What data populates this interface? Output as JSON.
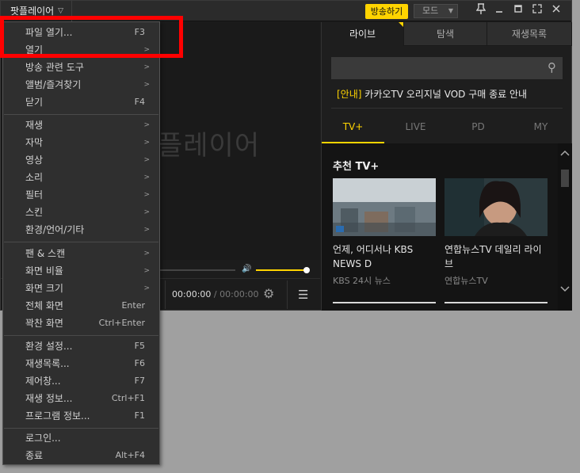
{
  "titlebar": {
    "app_menu_label": "팟플레이어",
    "broadcast_label": "방송하기",
    "mode_label": "모드"
  },
  "video": {
    "watermark": "플레이어",
    "time_current": "00:00:00",
    "time_separator": "/",
    "time_total": "00:00:00",
    "volume_level": 1.0
  },
  "panel": {
    "tabs": [
      {
        "label": "라이브"
      },
      {
        "label": "탐색"
      },
      {
        "label": "재생목록"
      }
    ],
    "notice_tag": "[안내]",
    "notice_text": "카카오TV 오리지널 VOD 구매 종료 안내",
    "subtabs": [
      {
        "label": "TV+"
      },
      {
        "label": "LIVE"
      },
      {
        "label": "PD"
      },
      {
        "label": "MY"
      }
    ],
    "section_title": "추천 TV+",
    "cards": [
      {
        "title": "언제, 어디서나 KBS NEWS D",
        "channel": "KBS 24시 뉴스"
      },
      {
        "title": "연합뉴스TV 데일리 라이브",
        "channel": "연합뉴스TV"
      }
    ]
  },
  "menu": {
    "items": [
      {
        "label": "파일 열기...",
        "shortcut": "F3",
        "submenu": false
      },
      {
        "label": "열기",
        "shortcut": "",
        "submenu": true
      },
      {
        "label": "방송 관련 도구",
        "shortcut": "",
        "submenu": true
      },
      {
        "label": "앨범/즐겨찾기",
        "shortcut": "",
        "submenu": true
      },
      {
        "label": "닫기",
        "shortcut": "F4",
        "submenu": false
      },
      {
        "label": "재생",
        "shortcut": "",
        "submenu": true
      },
      {
        "label": "자막",
        "shortcut": "",
        "submenu": true
      },
      {
        "label": "영상",
        "shortcut": "",
        "submenu": true
      },
      {
        "label": "소리",
        "shortcut": "",
        "submenu": true
      },
      {
        "label": "필터",
        "shortcut": "",
        "submenu": true
      },
      {
        "label": "스킨",
        "shortcut": "",
        "submenu": true
      },
      {
        "label": "환경/언어/기타",
        "shortcut": "",
        "submenu": true
      },
      {
        "label": "팬 & 스캔",
        "shortcut": "",
        "submenu": true
      },
      {
        "label": "화면 비율",
        "shortcut": "",
        "submenu": true
      },
      {
        "label": "화면 크기",
        "shortcut": "",
        "submenu": true
      },
      {
        "label": "전체 화면",
        "shortcut": "Enter",
        "submenu": false
      },
      {
        "label": "꽉찬 화면",
        "shortcut": "Ctrl+Enter",
        "submenu": false
      },
      {
        "label": "환경 설정...",
        "shortcut": "F5",
        "submenu": false
      },
      {
        "label": "재생목록...",
        "shortcut": "F6",
        "submenu": false
      },
      {
        "label": "제어창...",
        "shortcut": "F7",
        "submenu": false
      },
      {
        "label": "재생 정보...",
        "shortcut": "Ctrl+F1",
        "submenu": false
      },
      {
        "label": "프로그램 정보...",
        "shortcut": "F1",
        "submenu": false
      },
      {
        "label": "로그인...",
        "shortcut": "",
        "submenu": false
      },
      {
        "label": "종료",
        "shortcut": "Alt+F4",
        "submenu": false
      }
    ],
    "submenu_glyph": ">"
  },
  "colors": {
    "accent": "#ffd400",
    "highlight_box": "#ff0000",
    "background": "#a0a0a0"
  }
}
